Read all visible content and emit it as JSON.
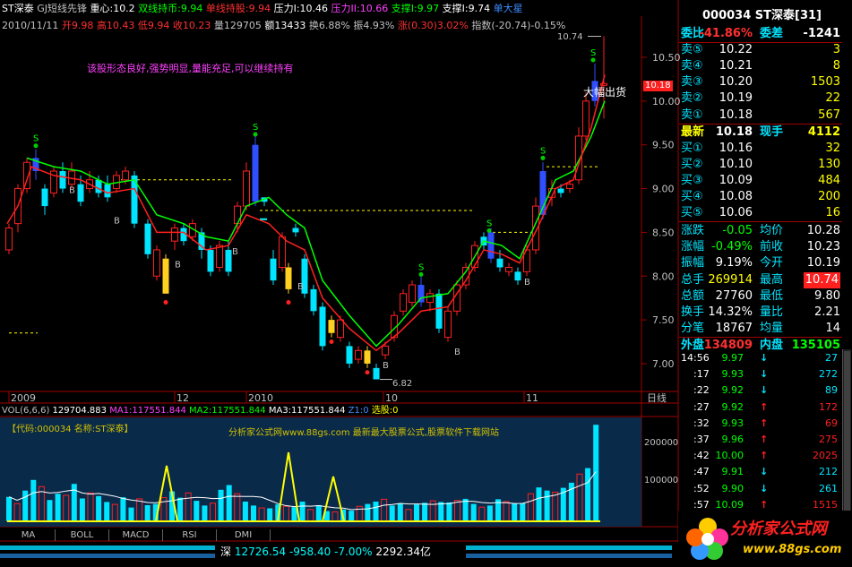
{
  "header": {
    "stock": "ST深泰",
    "indicator": "GJ短线先锋",
    "segments": [
      {
        "text": "重心:10.2",
        "color": "#ffffff"
      },
      {
        "text": "双线持币:9.94",
        "color": "#00ff00"
      },
      {
        "text": "单线持股:9.94",
        "color": "#ff3030"
      },
      {
        "text": "压力I:10.46",
        "color": "#ffffff"
      },
      {
        "text": "压力II:10.66",
        "color": "#ff40ff"
      },
      {
        "text": "支撑I:9.97",
        "color": "#00ff00"
      },
      {
        "text": "支撑I:9.74",
        "color": "#ffffff"
      },
      {
        "text": "单大星",
        "color": "#3c8cff"
      }
    ]
  },
  "ohlc_line": {
    "date": "2010/11/11",
    "open": "开9.98",
    "high": "高10.43",
    "low": "低9.94",
    "close": "收10.23",
    "vol": "量129705",
    "amount": "额13433",
    "turnover": "换6.88%",
    "amplitude": "振4.93%",
    "change": "涨(0.30)3.02%",
    "index": "指数(-20.74)-0.15%"
  },
  "annotation_text": "该股形态良好,强势明显,量能充足,可以继续持有",
  "sell_label": "大幅出货",
  "price_high_label": "10.74",
  "price_low_label": "6.82",
  "current_price_tag": "10.18",
  "price_axis": [
    "10.50",
    "10.00",
    "9.50",
    "9.00",
    "8.50",
    "8.00",
    "7.50",
    "7.00"
  ],
  "date_axis": [
    "2009",
    "12",
    "2010",
    "10",
    "11"
  ],
  "date_axis_label": "日线",
  "volume_header": {
    "vol": "VOL(6,6,6)",
    "vol_value": "129704.883",
    "ma1": "MA1:117551.844",
    "ma2": "MA2:117551.844",
    "ma3": "MA3:117551.844",
    "z": "Z1:0",
    "select": "选股:0"
  },
  "volume_info": {
    "code": "【代码:000034 名称:ST深泰】",
    "ad": "分析家公式网www.88gs.com 最新最大股票公式,股票软件下载网站"
  },
  "volume_axis": [
    "200000",
    "100000"
  ],
  "bottom_tabs": [
    "MA",
    "BOLL",
    "MACD",
    "RSI",
    "DMI"
  ],
  "status_bar": {
    "market": "深",
    "index": "12726.54",
    "change": "-958.40",
    "pct": "-7.00%",
    "amount": "2292.34亿"
  },
  "logo_text": "分析家公式网",
  "logo_url": "www.88gs.com",
  "quote_title": "000034 ST深泰[31]",
  "quote_rows": [
    {
      "l": "委比",
      "v": "-41.86%",
      "l2": "委差",
      "v2": "-1241",
      "vc": "#ff3030",
      "v2c": "#ffffff"
    },
    {
      "l": "卖⑤",
      "v": "10.22",
      "l2": "",
      "v2": "3",
      "vc": "#ffffff",
      "v2c": "#ffff00"
    },
    {
      "l": "卖④",
      "v": "10.21",
      "l2": "",
      "v2": "8",
      "vc": "#ffffff",
      "v2c": "#ffff00"
    },
    {
      "l": "卖③",
      "v": "10.20",
      "l2": "",
      "v2": "1503",
      "vc": "#ffffff",
      "v2c": "#ffff00"
    },
    {
      "l": "卖②",
      "v": "10.19",
      "l2": "",
      "v2": "22",
      "vc": "#ffffff",
      "v2c": "#ffff00"
    },
    {
      "l": "卖①",
      "v": "10.18",
      "l2": "",
      "v2": "567",
      "vc": "#ffffff",
      "v2c": "#ffff00"
    },
    {
      "l": "最新",
      "v": "10.18",
      "l2": "现手",
      "v2": "4112",
      "vc": "#ffffff",
      "v2c": "#ffff00"
    },
    {
      "l": "买①",
      "v": "10.16",
      "l2": "",
      "v2": "32",
      "vc": "#ffffff",
      "v2c": "#ffff00"
    },
    {
      "l": "买②",
      "v": "10.10",
      "l2": "",
      "v2": "130",
      "vc": "#ffffff",
      "v2c": "#ffff00"
    },
    {
      "l": "买③",
      "v": "10.09",
      "l2": "",
      "v2": "484",
      "vc": "#ffffff",
      "v2c": "#ffff00"
    },
    {
      "l": "买④",
      "v": "10.08",
      "l2": "",
      "v2": "200",
      "vc": "#ffffff",
      "v2c": "#ffff00"
    },
    {
      "l": "买⑤",
      "v": "10.06",
      "l2": "",
      "v2": "16",
      "vc": "#ffffff",
      "v2c": "#ffff00"
    },
    {
      "l": "涨跌",
      "v": "-0.05",
      "l2": "均价",
      "v2": "10.28",
      "vc": "#00ff00",
      "v2c": "#ffffff"
    },
    {
      "l": "涨幅",
      "v": "-0.49%",
      "l2": "前收",
      "v2": "10.23",
      "vc": "#00ff00",
      "v2c": "#ffffff"
    },
    {
      "l": "振幅",
      "v": "9.19%",
      "l2": "今开",
      "v2": "10.19",
      "vc": "#ffffff",
      "v2c": "#ffffff"
    },
    {
      "l": "总手",
      "v": "269914",
      "l2": "最高",
      "v2": "10.74",
      "vc": "#ffff00",
      "v2c": "#ffffff"
    },
    {
      "l": "总额",
      "v": "27760",
      "l2": "最低",
      "v2": "9.80",
      "vc": "#ffffff",
      "v2c": "#ffffff"
    },
    {
      "l": "换手",
      "v": "14.32%",
      "l2": "量比",
      "v2": "2.21",
      "vc": "#ffffff",
      "v2c": "#ffffff"
    },
    {
      "l": "分笔",
      "v": "18767",
      "l2": "均量",
      "v2": "14",
      "vc": "#ffffff",
      "v2c": "#ffffff"
    },
    {
      "l": "外盘",
      "v": "134809",
      "l2": "内盘",
      "v2": "135105",
      "vc": "#ff3030",
      "v2c": "#00ff00"
    }
  ],
  "ticks": [
    {
      "t": "14:56",
      "p": "9.97",
      "a": "↓",
      "q": "27"
    },
    {
      "t": ":17",
      "p": "9.93",
      "a": "↓",
      "q": "272"
    },
    {
      "t": ":22",
      "p": "9.92",
      "a": "↓",
      "q": "89"
    },
    {
      "t": ":27",
      "p": "9.92",
      "a": "↑",
      "q": "172"
    },
    {
      "t": ":32",
      "p": "9.93",
      "a": "↑",
      "q": "69"
    },
    {
      "t": ":37",
      "p": "9.96",
      "a": "↑",
      "q": "275"
    },
    {
      "t": ":42",
      "p": "10.00",
      "a": "↑",
      "q": "2025"
    },
    {
      "t": ":47",
      "p": "9.91",
      "a": "↓",
      "q": "212"
    },
    {
      "t": ":52",
      "p": "9.90",
      "a": "↓",
      "q": "261"
    },
    {
      "t": ":57",
      "p": "10.09",
      "a": "↑",
      "q": "1515"
    }
  ]
}
